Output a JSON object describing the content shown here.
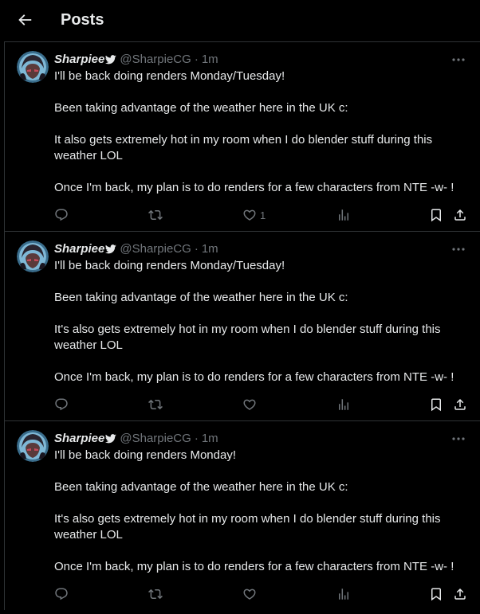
{
  "header": {
    "title": "Posts",
    "back_icon": "arrow-left-icon"
  },
  "colors": {
    "background": "#000000",
    "text": "#e7e9ea",
    "muted": "#71767b",
    "border": "#2f3336"
  },
  "posts": [
    {
      "display_name": "Sharpiee",
      "handle": "@SharpieCG",
      "separator": "·",
      "time": "1m",
      "paragraphs": [
        "I'll be back doing renders Monday/Tuesday!",
        "Been taking advantage of the weather here in the UK c:",
        "It also gets extremely hot in my room when I do blender stuff during this weather LOL",
        "Once I'm back, my plan is to do renders for a few characters from NTE -w- !"
      ],
      "like_count": "1"
    },
    {
      "display_name": "Sharpiee",
      "handle": "@SharpieCG",
      "separator": "·",
      "time": "1m",
      "paragraphs": [
        "I'll be back doing renders Monday/Tuesday!",
        "Been taking advantage of the weather here in the UK c:",
        "It's also gets extremely hot in my room when I do blender stuff during this weather LOL",
        "Once I'm back, my plan is to do renders for a few characters from NTE -w- !"
      ],
      "like_count": ""
    },
    {
      "display_name": "Sharpiee",
      "handle": "@SharpieCG",
      "separator": "·",
      "time": "1m",
      "paragraphs": [
        "I'll be back doing renders Monday!",
        "Been taking advantage of the weather here in the UK c:",
        "It's also gets extremely hot in my room when I do blender stuff during this weather LOL",
        "Once I'm back, my plan is to do renders for a few characters from NTE -w- !"
      ],
      "like_count": ""
    }
  ]
}
